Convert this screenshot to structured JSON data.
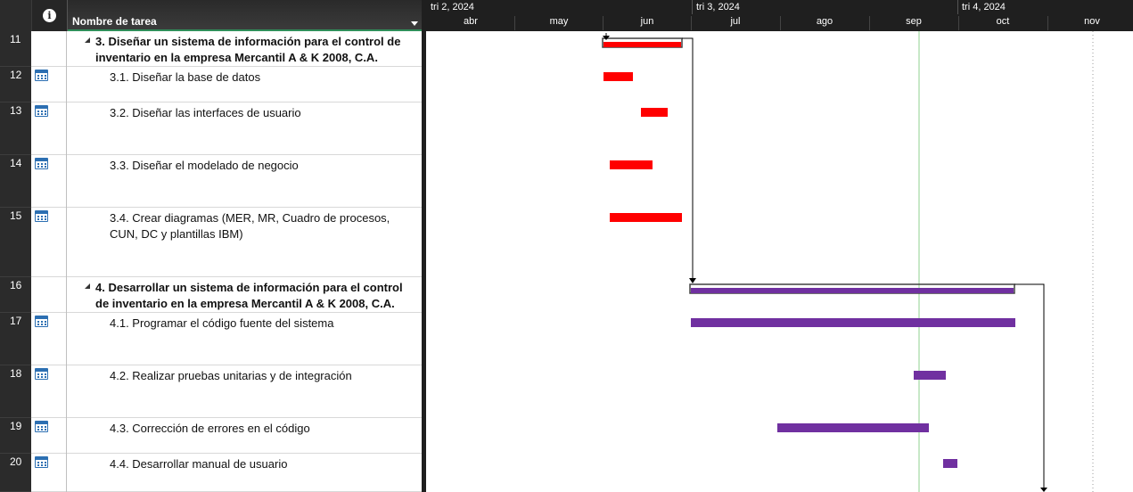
{
  "header": {
    "info_icon_glyph": "i",
    "name_column_label": "Nombre de tarea"
  },
  "timescale": {
    "quarters": [
      "tri 2, 2024",
      "tri 3, 2024",
      "tri 4, 2024"
    ],
    "months": [
      "abr",
      "may",
      "jun",
      "jul",
      "ago",
      "sep",
      "oct",
      "nov"
    ]
  },
  "rows": [
    {
      "id": "11",
      "name": "3. Diseñar un sistema de información para el control de inventario en la empresa Mercantil A & K 2008, C.A.",
      "summary": true,
      "bar_color": "red"
    },
    {
      "id": "12",
      "name": "3.1. Diseñar la base de datos",
      "summary": false,
      "bar_color": "red"
    },
    {
      "id": "13",
      "name": "3.2. Diseñar las interfaces de usuario",
      "summary": false,
      "bar_color": "red"
    },
    {
      "id": "14",
      "name": "3.3. Diseñar el modelado de negocio",
      "summary": false,
      "bar_color": "red"
    },
    {
      "id": "15",
      "name": "3.4. Crear diagramas (MER, MR, Cuadro de procesos, CUN, DC y plantillas IBM)",
      "summary": false,
      "bar_color": "red"
    },
    {
      "id": "16",
      "name": "4. Desarrollar un sistema de información para el control de inventario en la empresa Mercantil A & K 2008, C.A.",
      "summary": true,
      "bar_color": "purple"
    },
    {
      "id": "17",
      "name": "4.1. Programar el código fuente del sistema",
      "summary": false,
      "bar_color": "purple"
    },
    {
      "id": "18",
      "name": "4.2. Realizar pruebas unitarias y de integración",
      "summary": false,
      "bar_color": "purple"
    },
    {
      "id": "19",
      "name": "4.3. Corrección de errores en el código",
      "summary": false,
      "bar_color": "purple"
    },
    {
      "id": "20",
      "name": "4.4. Desarrollar manual de usuario",
      "summary": false,
      "bar_color": "purple"
    }
  ],
  "colors": {
    "red": "#ff0000",
    "purple": "#7030a0",
    "today_line": "#8fd18f",
    "summary_outline": "#404040"
  },
  "icons": {
    "info": "info-circle-icon",
    "task_type": "calendar-icon",
    "collapse": "collapse-triangle-icon"
  }
}
